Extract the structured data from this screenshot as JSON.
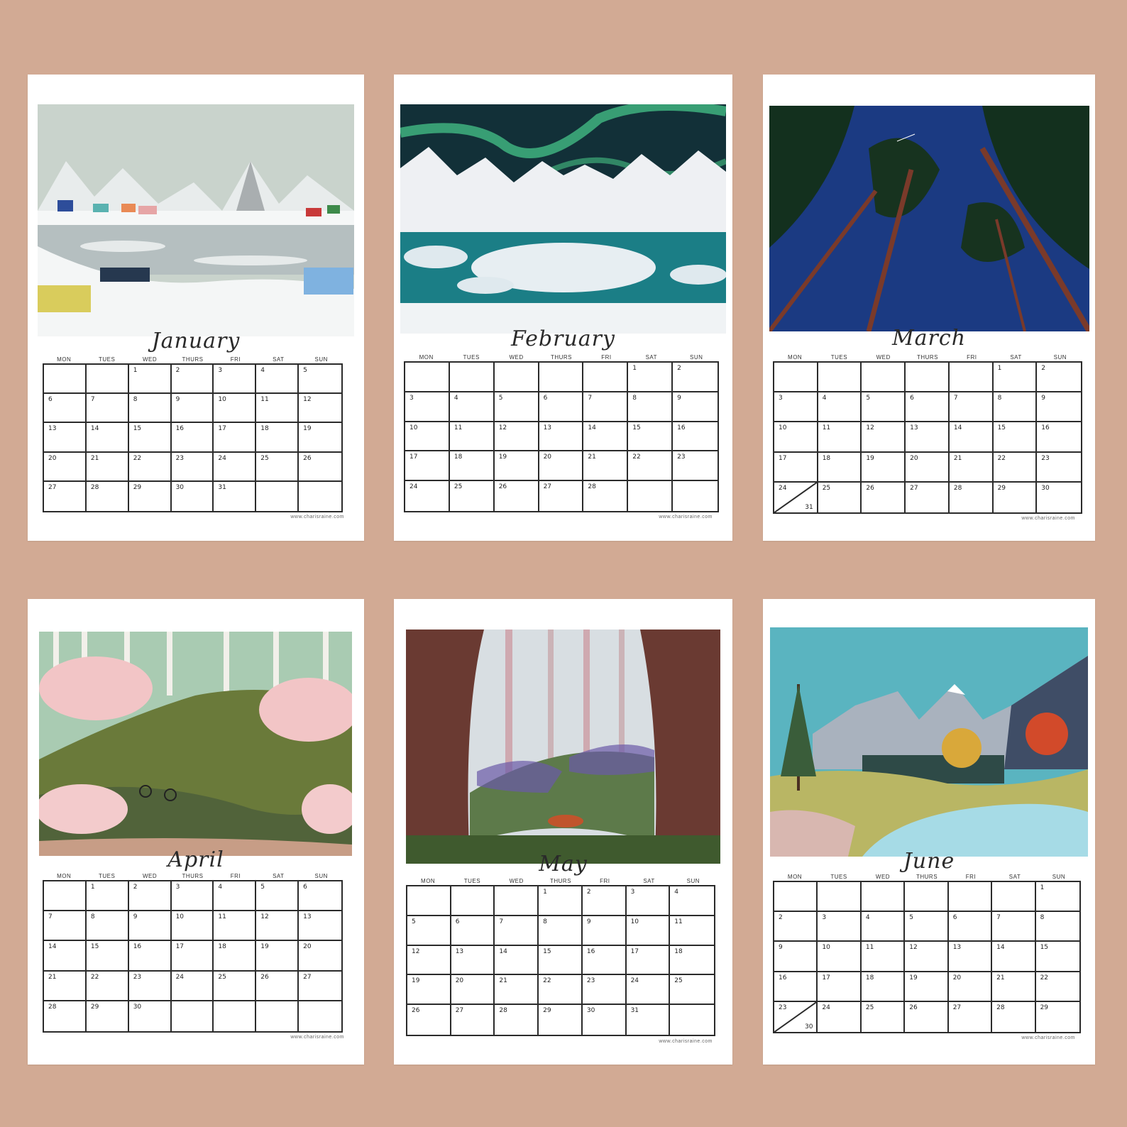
{
  "weekdays": [
    "MON",
    "TUES",
    "WED",
    "THURS",
    "FRI",
    "SAT",
    "SUN"
  ],
  "website": "www.charisraine.com",
  "months": [
    {
      "name": "January",
      "cells": [
        [
          "",
          ""
        ],
        [
          "",
          ""
        ],
        [
          "1",
          ""
        ],
        [
          "2",
          ""
        ],
        [
          "3",
          ""
        ],
        [
          "4",
          ""
        ],
        [
          "5",
          ""
        ],
        [
          "6",
          ""
        ],
        [
          "7",
          ""
        ],
        [
          "8",
          ""
        ],
        [
          "9",
          ""
        ],
        [
          "10",
          ""
        ],
        [
          "11",
          ""
        ],
        [
          "12",
          ""
        ],
        [
          "13",
          ""
        ],
        [
          "14",
          ""
        ],
        [
          "15",
          ""
        ],
        [
          "16",
          ""
        ],
        [
          "17",
          ""
        ],
        [
          "18",
          ""
        ],
        [
          "19",
          ""
        ],
        [
          "20",
          ""
        ],
        [
          "21",
          ""
        ],
        [
          "22",
          ""
        ],
        [
          "23",
          ""
        ],
        [
          "24",
          ""
        ],
        [
          "25",
          ""
        ],
        [
          "26",
          ""
        ],
        [
          "27",
          ""
        ],
        [
          "28",
          ""
        ],
        [
          "29",
          ""
        ],
        [
          "30",
          ""
        ],
        [
          "31",
          ""
        ],
        [
          "",
          ""
        ],
        [
          "",
          ""
        ]
      ]
    },
    {
      "name": "February",
      "cells": [
        [
          "",
          ""
        ],
        [
          "",
          ""
        ],
        [
          "",
          ""
        ],
        [
          "",
          ""
        ],
        [
          "",
          ""
        ],
        [
          "1",
          ""
        ],
        [
          "2",
          ""
        ],
        [
          "3",
          ""
        ],
        [
          "4",
          ""
        ],
        [
          "5",
          ""
        ],
        [
          "6",
          ""
        ],
        [
          "7",
          ""
        ],
        [
          "8",
          ""
        ],
        [
          "9",
          ""
        ],
        [
          "10",
          ""
        ],
        [
          "11",
          ""
        ],
        [
          "12",
          ""
        ],
        [
          "13",
          ""
        ],
        [
          "14",
          ""
        ],
        [
          "15",
          ""
        ],
        [
          "16",
          ""
        ],
        [
          "17",
          ""
        ],
        [
          "18",
          ""
        ],
        [
          "19",
          ""
        ],
        [
          "20",
          ""
        ],
        [
          "21",
          ""
        ],
        [
          "22",
          ""
        ],
        [
          "23",
          ""
        ],
        [
          "24",
          ""
        ],
        [
          "25",
          ""
        ],
        [
          "26",
          ""
        ],
        [
          "27",
          ""
        ],
        [
          "28",
          ""
        ],
        [
          "",
          ""
        ],
        [
          "",
          ""
        ]
      ]
    },
    {
      "name": "March",
      "cells": [
        [
          "",
          ""
        ],
        [
          "",
          ""
        ],
        [
          "",
          ""
        ],
        [
          "",
          ""
        ],
        [
          "",
          ""
        ],
        [
          "1",
          ""
        ],
        [
          "2",
          ""
        ],
        [
          "3",
          ""
        ],
        [
          "4",
          ""
        ],
        [
          "5",
          ""
        ],
        [
          "6",
          ""
        ],
        [
          "7",
          ""
        ],
        [
          "8",
          ""
        ],
        [
          "9",
          ""
        ],
        [
          "10",
          ""
        ],
        [
          "11",
          ""
        ],
        [
          "12",
          ""
        ],
        [
          "13",
          ""
        ],
        [
          "14",
          ""
        ],
        [
          "15",
          ""
        ],
        [
          "16",
          ""
        ],
        [
          "17",
          ""
        ],
        [
          "18",
          ""
        ],
        [
          "19",
          ""
        ],
        [
          "20",
          ""
        ],
        [
          "21",
          ""
        ],
        [
          "22",
          ""
        ],
        [
          "23",
          ""
        ],
        [
          "24",
          "31"
        ],
        [
          "25",
          ""
        ],
        [
          "26",
          ""
        ],
        [
          "27",
          ""
        ],
        [
          "28",
          ""
        ],
        [
          "29",
          ""
        ],
        [
          "30",
          ""
        ]
      ]
    },
    {
      "name": "April",
      "cells": [
        [
          "",
          ""
        ],
        [
          "1",
          ""
        ],
        [
          "2",
          ""
        ],
        [
          "3",
          ""
        ],
        [
          "4",
          ""
        ],
        [
          "5",
          ""
        ],
        [
          "6",
          ""
        ],
        [
          "7",
          ""
        ],
        [
          "8",
          ""
        ],
        [
          "9",
          ""
        ],
        [
          "10",
          ""
        ],
        [
          "11",
          ""
        ],
        [
          "12",
          ""
        ],
        [
          "13",
          ""
        ],
        [
          "14",
          ""
        ],
        [
          "15",
          ""
        ],
        [
          "16",
          ""
        ],
        [
          "17",
          ""
        ],
        [
          "18",
          ""
        ],
        [
          "19",
          ""
        ],
        [
          "20",
          ""
        ],
        [
          "21",
          ""
        ],
        [
          "22",
          ""
        ],
        [
          "23",
          ""
        ],
        [
          "24",
          ""
        ],
        [
          "25",
          ""
        ],
        [
          "26",
          ""
        ],
        [
          "27",
          ""
        ],
        [
          "28",
          ""
        ],
        [
          "29",
          ""
        ],
        [
          "30",
          ""
        ],
        [
          "",
          ""
        ],
        [
          "",
          ""
        ],
        [
          "",
          ""
        ],
        [
          "",
          ""
        ]
      ]
    },
    {
      "name": "May",
      "cells": [
        [
          "",
          ""
        ],
        [
          "",
          ""
        ],
        [
          "",
          ""
        ],
        [
          "1",
          ""
        ],
        [
          "2",
          ""
        ],
        [
          "3",
          ""
        ],
        [
          "4",
          ""
        ],
        [
          "5",
          ""
        ],
        [
          "6",
          ""
        ],
        [
          "7",
          ""
        ],
        [
          "8",
          ""
        ],
        [
          "9",
          ""
        ],
        [
          "10",
          ""
        ],
        [
          "11",
          ""
        ],
        [
          "12",
          ""
        ],
        [
          "13",
          ""
        ],
        [
          "14",
          ""
        ],
        [
          "15",
          ""
        ],
        [
          "16",
          ""
        ],
        [
          "17",
          ""
        ],
        [
          "18",
          ""
        ],
        [
          "19",
          ""
        ],
        [
          "20",
          ""
        ],
        [
          "21",
          ""
        ],
        [
          "22",
          ""
        ],
        [
          "23",
          ""
        ],
        [
          "24",
          ""
        ],
        [
          "25",
          ""
        ],
        [
          "26",
          ""
        ],
        [
          "27",
          ""
        ],
        [
          "28",
          ""
        ],
        [
          "29",
          ""
        ],
        [
          "30",
          ""
        ],
        [
          "31",
          ""
        ],
        [
          "",
          ""
        ]
      ]
    },
    {
      "name": "June",
      "cells": [
        [
          "",
          ""
        ],
        [
          "",
          ""
        ],
        [
          "",
          ""
        ],
        [
          "",
          ""
        ],
        [
          "",
          ""
        ],
        [
          "",
          ""
        ],
        [
          "1",
          ""
        ],
        [
          "2",
          ""
        ],
        [
          "3",
          ""
        ],
        [
          "4",
          ""
        ],
        [
          "5",
          ""
        ],
        [
          "6",
          ""
        ],
        [
          "7",
          ""
        ],
        [
          "8",
          ""
        ],
        [
          "9",
          ""
        ],
        [
          "10",
          ""
        ],
        [
          "11",
          ""
        ],
        [
          "12",
          ""
        ],
        [
          "13",
          ""
        ],
        [
          "14",
          ""
        ],
        [
          "15",
          ""
        ],
        [
          "16",
          ""
        ],
        [
          "17",
          ""
        ],
        [
          "18",
          ""
        ],
        [
          "19",
          ""
        ],
        [
          "20",
          ""
        ],
        [
          "21",
          ""
        ],
        [
          "22",
          ""
        ],
        [
          "23",
          "30"
        ],
        [
          "24",
          ""
        ],
        [
          "25",
          ""
        ],
        [
          "26",
          ""
        ],
        [
          "27",
          ""
        ],
        [
          "28",
          ""
        ],
        [
          "29",
          ""
        ]
      ]
    }
  ]
}
